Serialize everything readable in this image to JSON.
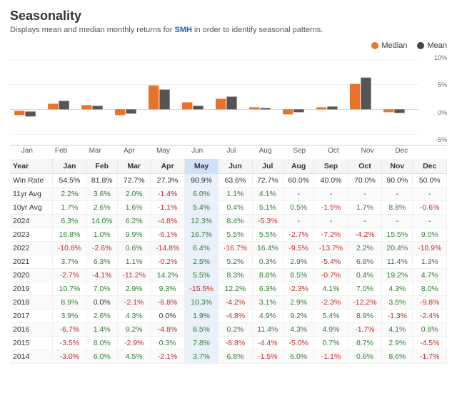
{
  "page": {
    "title": "Seasonality",
    "subtitle_pre": "Displays mean and median monthly returns for ",
    "ticker": "SMH",
    "subtitle_post": " in order to identify seasonal patterns."
  },
  "chart": {
    "legend": {
      "median": "Median",
      "mean": "Mean"
    },
    "months": [
      "Jan",
      "Feb",
      "Mar",
      "Apr",
      "May",
      "Jun",
      "Jul",
      "Aug",
      "Sep",
      "Oct",
      "Nov",
      "Dec"
    ]
  },
  "table": {
    "headers": [
      "Year",
      "Jan",
      "Feb",
      "Mar",
      "Apr",
      "May",
      "Jun",
      "Jul",
      "Aug",
      "Sep",
      "Oct",
      "Nov",
      "Dec"
    ],
    "rows": [
      {
        "label": "Win Rate",
        "values": [
          "54.5%",
          "81.8%",
          "72.7%",
          "27.3%",
          "90.9%",
          "63.6%",
          "72.7%",
          "60.0%",
          "40.0%",
          "70.0%",
          "90.0%",
          "50.0%"
        ],
        "types": [
          "n",
          "n",
          "n",
          "n",
          "n",
          "n",
          "n",
          "n",
          "n",
          "n",
          "n",
          "n"
        ]
      },
      {
        "label": "11yr Avg",
        "values": [
          "2.2%",
          "3.6%",
          "2.0%",
          "-1.4%",
          "6.0%",
          "1.1%",
          "4.1%",
          "-",
          "-",
          "-",
          "-",
          "-"
        ],
        "types": [
          "p",
          "p",
          "p",
          "neg",
          "p",
          "p",
          "p",
          "n",
          "n",
          "n",
          "n",
          "n"
        ]
      },
      {
        "label": "10yr Avg",
        "values": [
          "1.7%",
          "2.6%",
          "1.6%",
          "-1.1%",
          "5.4%",
          "0.4%",
          "5.1%",
          "0.5%",
          "-1.5%",
          "1.7%",
          "8.8%",
          "-0.6%"
        ],
        "types": [
          "p",
          "p",
          "p",
          "neg",
          "p",
          "p",
          "p",
          "p",
          "neg",
          "p",
          "p",
          "neg"
        ]
      },
      {
        "label": "2024",
        "values": [
          "6.3%",
          "14.0%",
          "6.2%",
          "-4.8%",
          "12.3%",
          "8.4%",
          "-5.3%",
          "-",
          "-",
          "-",
          "-",
          "-"
        ],
        "types": [
          "p",
          "p",
          "p",
          "neg",
          "p",
          "p",
          "neg",
          "n",
          "n",
          "n",
          "n",
          "n"
        ]
      },
      {
        "label": "2023",
        "values": [
          "16.8%",
          "1.0%",
          "9.9%",
          "-6.1%",
          "16.7%",
          "5.5%",
          "5.5%",
          "-2.7%",
          "-7.2%",
          "-4.2%",
          "15.5%",
          "9.0%"
        ],
        "types": [
          "p",
          "p",
          "p",
          "neg",
          "p",
          "p",
          "p",
          "neg",
          "neg",
          "neg",
          "p",
          "p"
        ]
      },
      {
        "label": "2022",
        "values": [
          "-10.8%",
          "-2.6%",
          "0.6%",
          "-14.8%",
          "6.4%",
          "-16.7%",
          "16.4%",
          "-9.5%",
          "-13.7%",
          "2.2%",
          "20.4%",
          "-10.9%"
        ],
        "types": [
          "neg",
          "neg",
          "p",
          "neg",
          "p",
          "neg",
          "p",
          "neg",
          "neg",
          "p",
          "p",
          "neg"
        ]
      },
      {
        "label": "2021",
        "values": [
          "3.7%",
          "6.3%",
          "1.1%",
          "-0.2%",
          "2.5%",
          "5.2%",
          "0.3%",
          "2.9%",
          "-5.4%",
          "6.8%",
          "11.4%",
          "1.3%"
        ],
        "types": [
          "p",
          "p",
          "p",
          "neg",
          "p",
          "p",
          "p",
          "p",
          "neg",
          "p",
          "p",
          "p"
        ]
      },
      {
        "label": "2020",
        "values": [
          "-2.7%",
          "-4.1%",
          "-11.2%",
          "14.2%",
          "5.5%",
          "8.3%",
          "8.8%",
          "8.5%",
          "-0.7%",
          "0.4%",
          "19.2%",
          "4.7%"
        ],
        "types": [
          "neg",
          "neg",
          "neg",
          "p",
          "p",
          "p",
          "p",
          "p",
          "neg",
          "p",
          "p",
          "p"
        ]
      },
      {
        "label": "2019",
        "values": [
          "10.7%",
          "7.0%",
          "2.9%",
          "9.3%",
          "-15.5%",
          "12.2%",
          "6.3%",
          "-2.3%",
          "4.1%",
          "7.0%",
          "4.3%",
          "8.0%"
        ],
        "types": [
          "p",
          "p",
          "p",
          "p",
          "neg",
          "p",
          "p",
          "neg",
          "p",
          "p",
          "p",
          "p"
        ]
      },
      {
        "label": "2018",
        "values": [
          "8.9%",
          "0.0%",
          "-2.1%",
          "-6.8%",
          "10.3%",
          "-4.2%",
          "3.1%",
          "2.9%",
          "-2.3%",
          "-12.2%",
          "3.5%",
          "-9.8%"
        ],
        "types": [
          "p",
          "n",
          "neg",
          "neg",
          "p",
          "neg",
          "p",
          "p",
          "neg",
          "neg",
          "p",
          "neg"
        ]
      },
      {
        "label": "2017",
        "values": [
          "3.9%",
          "2.6%",
          "4.3%",
          "0.0%",
          "1.9%",
          "-4.8%",
          "4.9%",
          "9.2%",
          "5.4%",
          "8.9%",
          "-1.3%",
          "-2.4%"
        ],
        "types": [
          "p",
          "p",
          "p",
          "n",
          "p",
          "neg",
          "p",
          "p",
          "p",
          "p",
          "neg",
          "neg"
        ]
      },
      {
        "label": "2016",
        "values": [
          "-6.7%",
          "1.4%",
          "9.2%",
          "-4.8%",
          "8.5%",
          "0.2%",
          "11.4%",
          "4.3%",
          "4.9%",
          "-1.7%",
          "4.1%",
          "0.8%"
        ],
        "types": [
          "neg",
          "p",
          "p",
          "neg",
          "p",
          "p",
          "p",
          "p",
          "p",
          "neg",
          "p",
          "p"
        ]
      },
      {
        "label": "2015",
        "values": [
          "-3.5%",
          "8.0%",
          "-2.9%",
          "0.3%",
          "7.8%",
          "-8.8%",
          "-4.4%",
          "-5.0%",
          "0.7%",
          "8.7%",
          "2.9%",
          "-4.5%"
        ],
        "types": [
          "neg",
          "p",
          "neg",
          "p",
          "p",
          "neg",
          "neg",
          "neg",
          "p",
          "p",
          "p",
          "neg"
        ]
      },
      {
        "label": "2014",
        "values": [
          "-3.0%",
          "6.0%",
          "4.5%",
          "-2.1%",
          "3.7%",
          "6.8%",
          "-1.5%",
          "6.0%",
          "-1.1%",
          "0.6%",
          "8.6%",
          "-1.7%"
        ],
        "types": [
          "neg",
          "p",
          "p",
          "neg",
          "p",
          "p",
          "neg",
          "p",
          "neg",
          "p",
          "p",
          "neg"
        ]
      }
    ]
  }
}
